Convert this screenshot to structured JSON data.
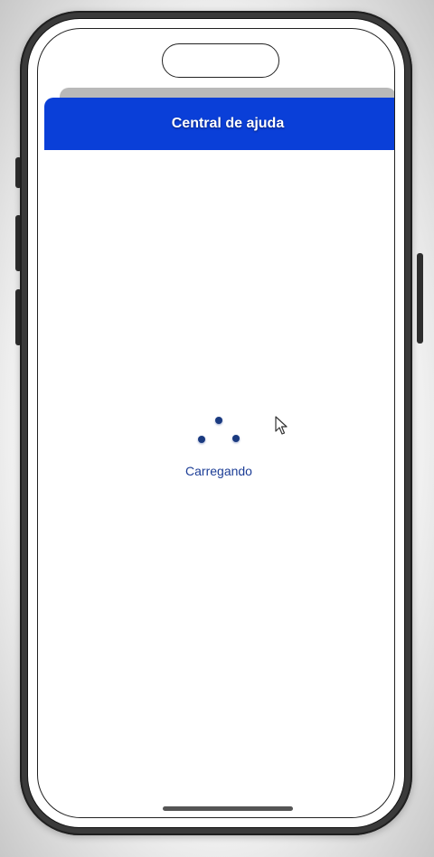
{
  "header": {
    "title": "Central de ajuda",
    "color": "#0A3FD8"
  },
  "loader": {
    "label": "Carregando",
    "dot_color": "#1A3A80"
  },
  "icons": {
    "cursor": "mouse-pointer-icon",
    "loader": "spinner-dots-icon"
  }
}
